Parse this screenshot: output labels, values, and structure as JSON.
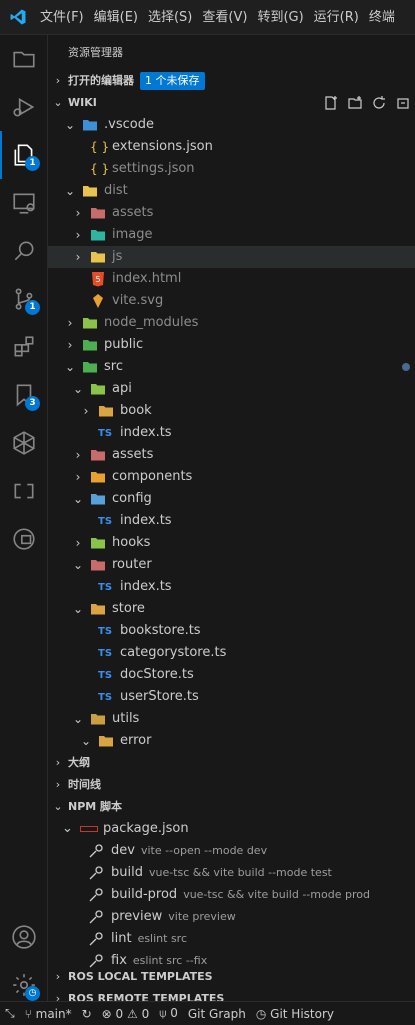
{
  "menu": [
    "文件(F)",
    "编辑(E)",
    "选择(S)",
    "查看(V)",
    "转到(G)",
    "运行(R)",
    "终端"
  ],
  "activity": {
    "explorer_badge": "1",
    "scm_badge": "1",
    "bookmark_badge": "3"
  },
  "sidebar": {
    "title": "资源管理器",
    "open_editors": {
      "label": "打开的编辑器",
      "badge": "1 个未保存"
    },
    "workspace": {
      "label": "WIKI"
    }
  },
  "tree": [
    {
      "label": ".vscode",
      "depth": 1,
      "type": "folder",
      "open": true,
      "icon": "vscode-folder-icon",
      "color": "#3d8fd6"
    },
    {
      "label": "extensions.json",
      "depth": 2,
      "type": "file",
      "icon": "json-icon"
    },
    {
      "label": "settings.json",
      "depth": 2,
      "type": "file",
      "icon": "json-icon",
      "dim": true
    },
    {
      "label": "dist",
      "depth": 1,
      "type": "folder",
      "open": true,
      "icon": "dist-folder-icon",
      "color": "#e8c34f",
      "dim": true
    },
    {
      "label": "assets",
      "depth": 2,
      "type": "folder",
      "open": false,
      "icon": "assets-folder-icon",
      "color": "#c86b6b",
      "dim": true
    },
    {
      "label": "image",
      "depth": 2,
      "type": "folder",
      "open": false,
      "icon": "image-folder-icon",
      "color": "#2fb59f",
      "dim": true
    },
    {
      "label": "js",
      "depth": 2,
      "type": "folder",
      "open": false,
      "icon": "js-folder-icon",
      "color": "#e8c34f",
      "dim": true,
      "selected": true
    },
    {
      "label": "index.html",
      "depth": 2,
      "type": "file",
      "icon": "html-icon",
      "dim": true
    },
    {
      "label": "vite.svg",
      "depth": 2,
      "type": "file",
      "icon": "svg-icon",
      "dim": true
    },
    {
      "label": "node_modules",
      "depth": 1,
      "type": "folder",
      "open": false,
      "icon": "node-folder-icon",
      "color": "#8bc34a",
      "dim": true
    },
    {
      "label": "public",
      "depth": 1,
      "type": "folder",
      "open": false,
      "icon": "public-folder-icon",
      "color": "#4caf50"
    },
    {
      "label": "src",
      "depth": 1,
      "type": "folder",
      "open": true,
      "icon": "src-folder-icon",
      "color": "#4caf50"
    },
    {
      "label": "api",
      "depth": 2,
      "type": "folder",
      "open": true,
      "icon": "api-folder-icon",
      "color": "#8bc34a"
    },
    {
      "label": "book",
      "depth": 3,
      "type": "folder",
      "open": false,
      "icon": "folder-icon",
      "color": "#d9a441"
    },
    {
      "label": "index.ts",
      "depth": 3,
      "type": "file",
      "icon": "ts-icon"
    },
    {
      "label": "assets",
      "depth": 2,
      "type": "folder",
      "open": false,
      "icon": "assets-folder-icon",
      "color": "#c86b6b"
    },
    {
      "label": "components",
      "depth": 2,
      "type": "folder",
      "open": false,
      "icon": "components-folder-icon",
      "color": "#e8a030"
    },
    {
      "label": "config",
      "depth": 2,
      "type": "folder",
      "open": true,
      "icon": "config-folder-icon",
      "color": "#5aa0d8"
    },
    {
      "label": "index.ts",
      "depth": 3,
      "type": "file",
      "icon": "ts-icon"
    },
    {
      "label": "hooks",
      "depth": 2,
      "type": "folder",
      "open": false,
      "icon": "hooks-folder-icon",
      "color": "#8bc34a"
    },
    {
      "label": "router",
      "depth": 2,
      "type": "folder",
      "open": true,
      "icon": "router-folder-icon",
      "color": "#c86b6b"
    },
    {
      "label": "index.ts",
      "depth": 3,
      "type": "file",
      "icon": "ts-icon"
    },
    {
      "label": "store",
      "depth": 2,
      "type": "folder",
      "open": true,
      "icon": "store-folder-icon",
      "color": "#d9a441"
    },
    {
      "label": "bookstore.ts",
      "depth": 3,
      "type": "file",
      "icon": "ts-icon"
    },
    {
      "label": "categorystore.ts",
      "depth": 3,
      "type": "file",
      "icon": "ts-icon"
    },
    {
      "label": "docStore.ts",
      "depth": 3,
      "type": "file",
      "icon": "ts-icon"
    },
    {
      "label": "userStore.ts",
      "depth": 3,
      "type": "file",
      "icon": "ts-icon"
    },
    {
      "label": "utils",
      "depth": 2,
      "type": "folder",
      "open": true,
      "icon": "utils-folder-icon",
      "color": "#c9a040"
    },
    {
      "label": "error",
      "depth": 3,
      "type": "folder",
      "open": true,
      "icon": "folder-icon",
      "color": "#d9a441"
    }
  ],
  "sections": {
    "outline": "大纲",
    "timeline": "时间线",
    "npm": "NPM 脚本",
    "ros_local": "ROS LOCAL TEMPLATES",
    "ros_remote": "ROS REMOTE TEMPLATES"
  },
  "npm": {
    "package": "package.json",
    "scripts": [
      {
        "name": "dev",
        "cmd": "vite --open --mode dev"
      },
      {
        "name": "build",
        "cmd": "vue-tsc && vite build --mode test"
      },
      {
        "name": "build-prod",
        "cmd": "vue-tsc && vite build --mode prod"
      },
      {
        "name": "preview",
        "cmd": "vite preview"
      },
      {
        "name": "lint",
        "cmd": "eslint src"
      },
      {
        "name": "fix",
        "cmd": "eslint src --fix"
      }
    ]
  },
  "status": {
    "branch": "main*",
    "errors": "0",
    "warnings": "0",
    "ports": "0",
    "git_graph": "Git Graph",
    "git_history": "Git History"
  },
  "colors": {
    "accent": "#0078d4",
    "background": "#181818",
    "ts": "#3b8eea",
    "json": "#e8c34f"
  }
}
